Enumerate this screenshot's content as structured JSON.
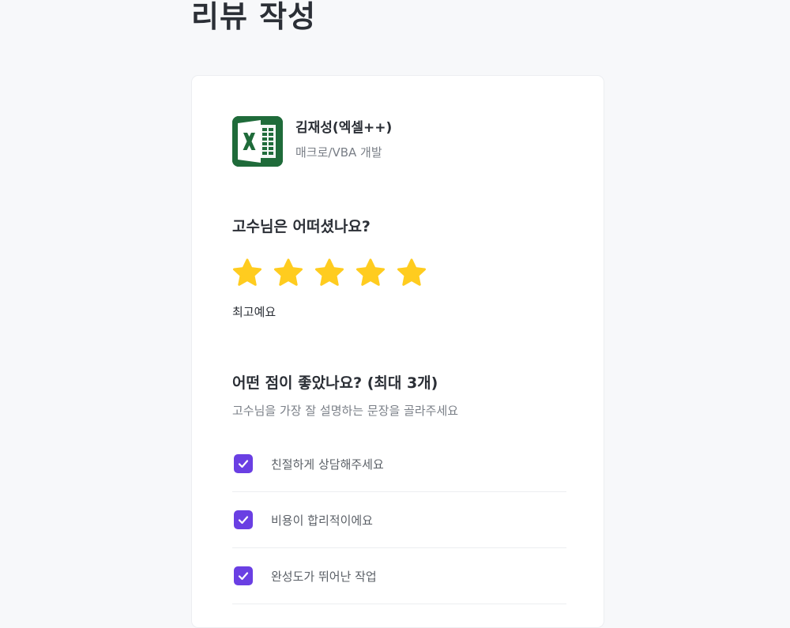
{
  "page": {
    "title": "리뷰 작성"
  },
  "expert": {
    "name": "김재성(엑셀++)",
    "category": "매크로/VBA 개발",
    "logo_icon": "excel-icon",
    "logo_color": "#1f6b3a"
  },
  "rating": {
    "question": "고수님은 어떠셨나요?",
    "value": 5,
    "max": 5,
    "label": "최고예요",
    "star_color": "#ffcc1f"
  },
  "good_points": {
    "question": "어떤 점이 좋았나요? (최대 3개)",
    "subtitle": "고수님을 가장 잘 설명하는 문장을 골라주세요",
    "check_color": "#6a3fe3",
    "options": [
      {
        "label": "친절하게 상담해주세요",
        "checked": true
      },
      {
        "label": "비용이 합리적이에요",
        "checked": true
      },
      {
        "label": "완성도가 뛰어난 작업",
        "checked": true
      }
    ]
  }
}
